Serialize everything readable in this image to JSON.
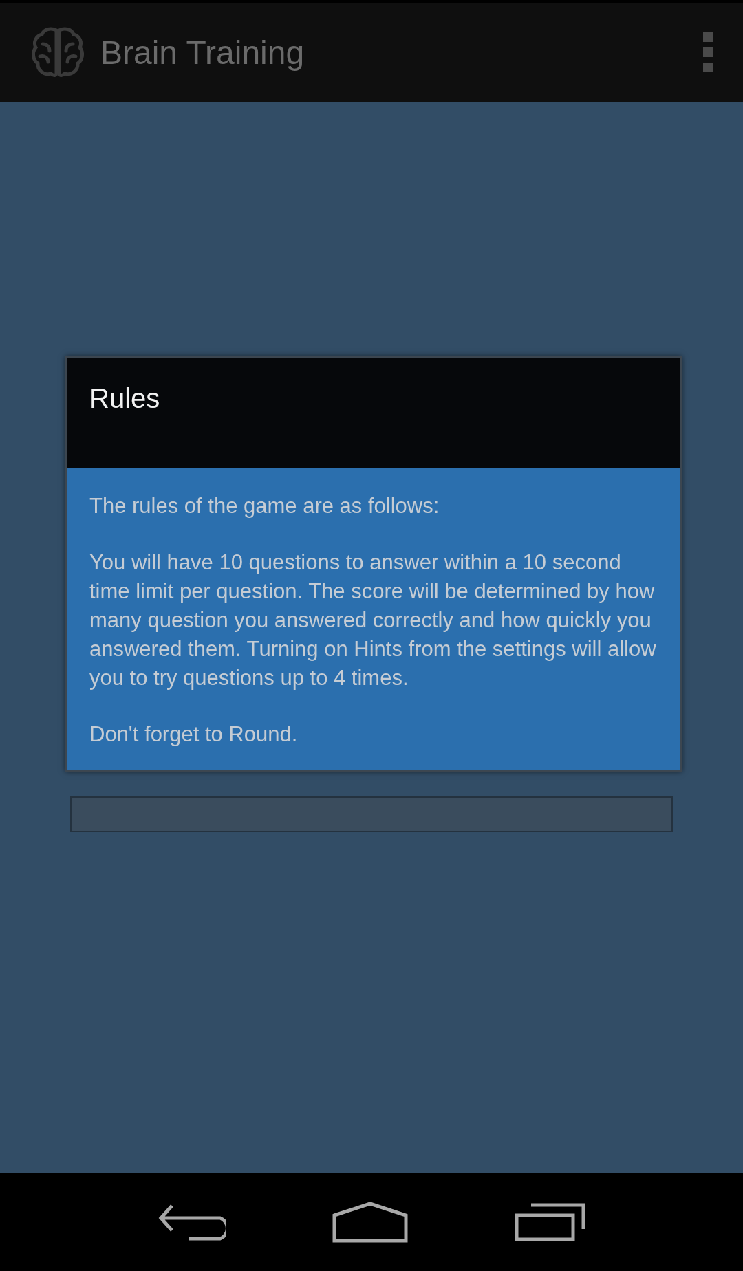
{
  "app_bar": {
    "title": "Brain Training"
  },
  "dialog": {
    "title": "Rules",
    "paragraphs": [
      "The rules of the game are as follows:",
      "You will have 10 questions to answer within a 10 second time limit per question. The score will be determined by how many question you answered correctly and how quickly you answered them. Turning on Hints from the settings will allow you to try questions up to 4 times.",
      "Don't forget to Round."
    ]
  }
}
